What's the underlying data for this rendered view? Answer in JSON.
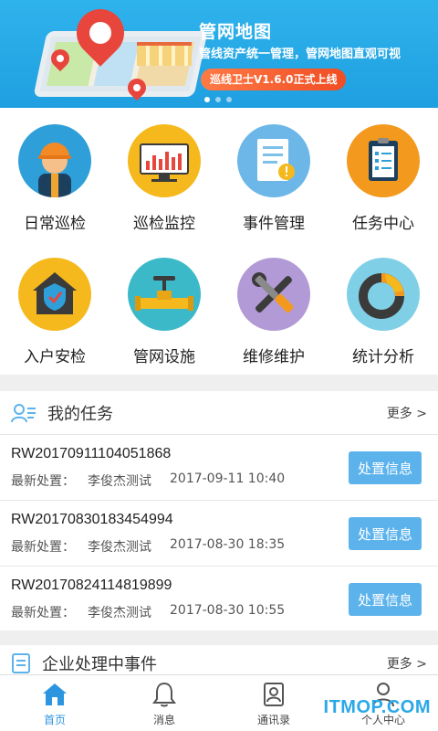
{
  "banner": {
    "title": "管网地图",
    "subtitle": "管线资产统一管理，管网地图直观可视",
    "ribbon": "巡线卫士V1.6.0正式上线",
    "page_count": 3,
    "active_page": 1
  },
  "grid": {
    "items": [
      {
        "label": "日常巡检",
        "icon": "worker-icon"
      },
      {
        "label": "巡检监控",
        "icon": "monitor-chart-icon"
      },
      {
        "label": "事件管理",
        "icon": "document-alert-icon"
      },
      {
        "label": "任务中心",
        "icon": "clipboard-icon"
      },
      {
        "label": "入户安检",
        "icon": "house-shield-icon"
      },
      {
        "label": "管网设施",
        "icon": "pipe-valve-icon"
      },
      {
        "label": "维修维护",
        "icon": "wrench-screwdriver-icon"
      },
      {
        "label": "统计分析",
        "icon": "donut-chart-icon"
      }
    ]
  },
  "tasks": {
    "title": "我的任务",
    "more": "更多 >",
    "rows": [
      {
        "id": "RW20170911104051868",
        "label": "最新处置：",
        "person": "李俊杰测试",
        "time": "2017-09-11 10:40",
        "button": "处置信息"
      },
      {
        "id": "RW20170830183454994",
        "label": "最新处置：",
        "person": "李俊杰测试",
        "time": "2017-08-30 18:35",
        "button": "处置信息"
      },
      {
        "id": "RW20170824114819899",
        "label": "最新处置：",
        "person": "李俊杰测试",
        "time": "2017-08-30 10:55",
        "button": "处置信息"
      }
    ]
  },
  "events": {
    "title": "企业处理中事件",
    "more": "更多 >"
  },
  "nav": {
    "items": [
      {
        "label": "首页",
        "icon": "home-icon",
        "active": true
      },
      {
        "label": "消息",
        "icon": "bell-icon",
        "active": false
      },
      {
        "label": "通讯录",
        "icon": "contacts-icon",
        "active": false
      },
      {
        "label": "个人中心",
        "icon": "person-icon",
        "active": false
      }
    ]
  },
  "watermark": "ITMOP.COM",
  "colors": {
    "banner": "#1f9fe0",
    "button": "#5cb3ec",
    "nav_active": "#2c95e0"
  }
}
